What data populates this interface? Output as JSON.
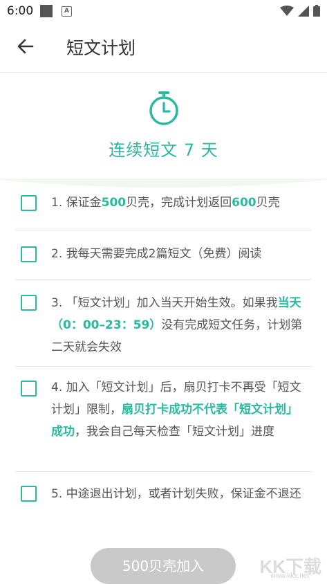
{
  "status_bar": {
    "time": "6:00",
    "a_badge": "A"
  },
  "header": {
    "title": "短文计划"
  },
  "hero": {
    "title": "连续短文 7 天"
  },
  "items": [
    {
      "parts": [
        {
          "t": "1. 保证金"
        },
        {
          "t": "500",
          "h": true
        },
        {
          "t": "贝壳，完成计划返回"
        },
        {
          "t": "600",
          "h": true
        },
        {
          "t": "贝壳"
        }
      ]
    },
    {
      "parts": [
        {
          "t": "2. 我每天需要完成2篇短文（免费）阅读"
        }
      ]
    },
    {
      "parts": [
        {
          "t": "3. 「短文计划」加入当天开始生效。如果我"
        },
        {
          "t": "当天（0：00–23：59）",
          "h": true
        },
        {
          "t": "没有完成短文任务，计划第二天就会失效"
        }
      ]
    },
    {
      "parts": [
        {
          "t": "4. 加入「短文计划」后，扇贝打卡不再受「短文计划」限制，"
        },
        {
          "t": "扇贝打卡成功不代表「短文计划」成功",
          "h": true
        },
        {
          "t": "，我会自己每天检查「短文计划」进度"
        }
      ]
    },
    {
      "parts": [
        {
          "t": "5. 中途退出计划，或者计划失败，保证金不退还"
        }
      ]
    }
  ],
  "join_button": {
    "label": "500贝壳加入"
  },
  "watermark": {
    "text": "KK下载",
    "url": "www.kkx.net"
  },
  "colors": {
    "accent": "#2bb9a0",
    "button_disabled": "#c9c9c9"
  }
}
